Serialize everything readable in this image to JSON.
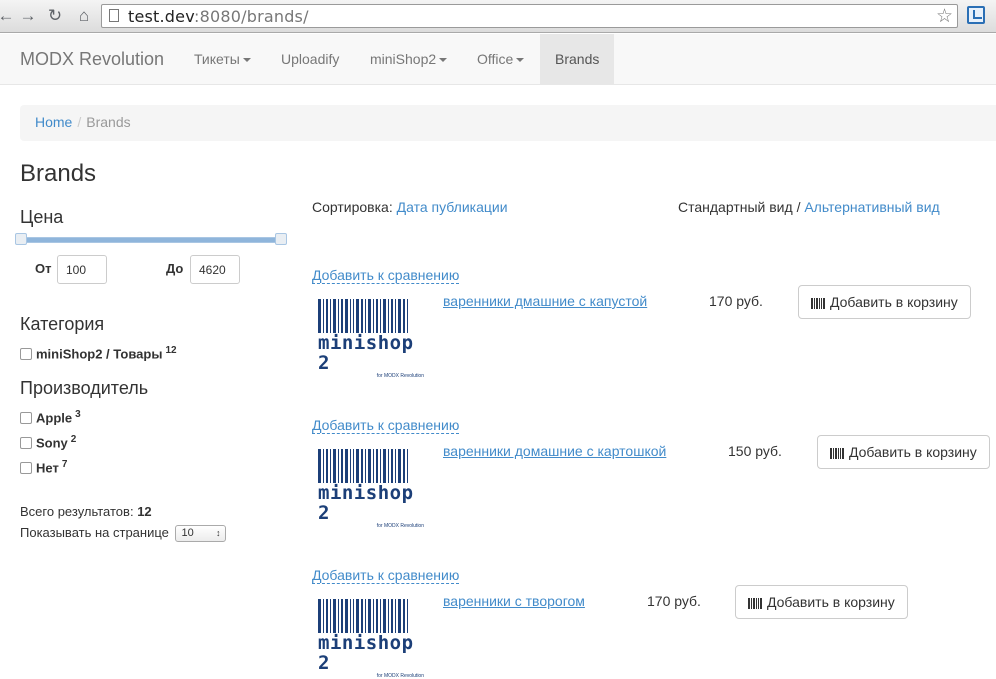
{
  "browser": {
    "url_host": "test.dev",
    "url_rest": ":8080/brands/"
  },
  "navbar": {
    "brand": "MODX Revolution",
    "items": [
      {
        "label": "Тикеты",
        "dropdown": true
      },
      {
        "label": "Uploadify",
        "dropdown": false
      },
      {
        "label": "miniShop2",
        "dropdown": true
      },
      {
        "label": "Office",
        "dropdown": true
      },
      {
        "label": "Brands",
        "dropdown": false,
        "active": true
      }
    ]
  },
  "breadcrumb": {
    "home": "Home",
    "separator": "/",
    "current": "Brands"
  },
  "page_title": "Brands",
  "filters": {
    "price": {
      "heading": "Цена",
      "from_label": "От",
      "from_value": "100",
      "to_label": "До",
      "to_value": "4620"
    },
    "category": {
      "heading": "Категория",
      "items": [
        {
          "label": "miniShop2 / Товары",
          "count": "12"
        }
      ]
    },
    "vendor": {
      "heading": "Производитель",
      "items": [
        {
          "label": "Apple",
          "count": "3"
        },
        {
          "label": "Sony",
          "count": "2"
        },
        {
          "label": "Нет",
          "count": "7"
        }
      ]
    },
    "total_label": "Всего результатов:",
    "total_value": "12",
    "perpage_label": "Показывать на странице",
    "perpage_value": "10"
  },
  "sort": {
    "label": "Сортировка:",
    "value": "Дата публикации"
  },
  "views": {
    "standard": "Стандартный вид",
    "separator": "/",
    "alternative": "Альтернативный вид"
  },
  "logo": {
    "word": "minishop 2",
    "tag": "for MODX Revolution"
  },
  "products": [
    {
      "compare": "Добавить к сравнению",
      "name": "варенники дмашние с капустой",
      "price": "170 руб.",
      "cart": "Добавить в корзину"
    },
    {
      "compare": "Добавить к сравнению",
      "name": "варенники домашние с картошкой",
      "price": "150 руб.",
      "cart": "Добавить в корзину"
    },
    {
      "compare": "Добавить к сравнению",
      "name": "варенники с творогом",
      "price": "170 руб.",
      "cart": "Добавить в корзину"
    }
  ],
  "colors": {
    "link": "#428bca",
    "logo": "#1c3f78",
    "navbar_bg": "#f8f8f8",
    "active_nav_bg": "#e7e7e7"
  }
}
